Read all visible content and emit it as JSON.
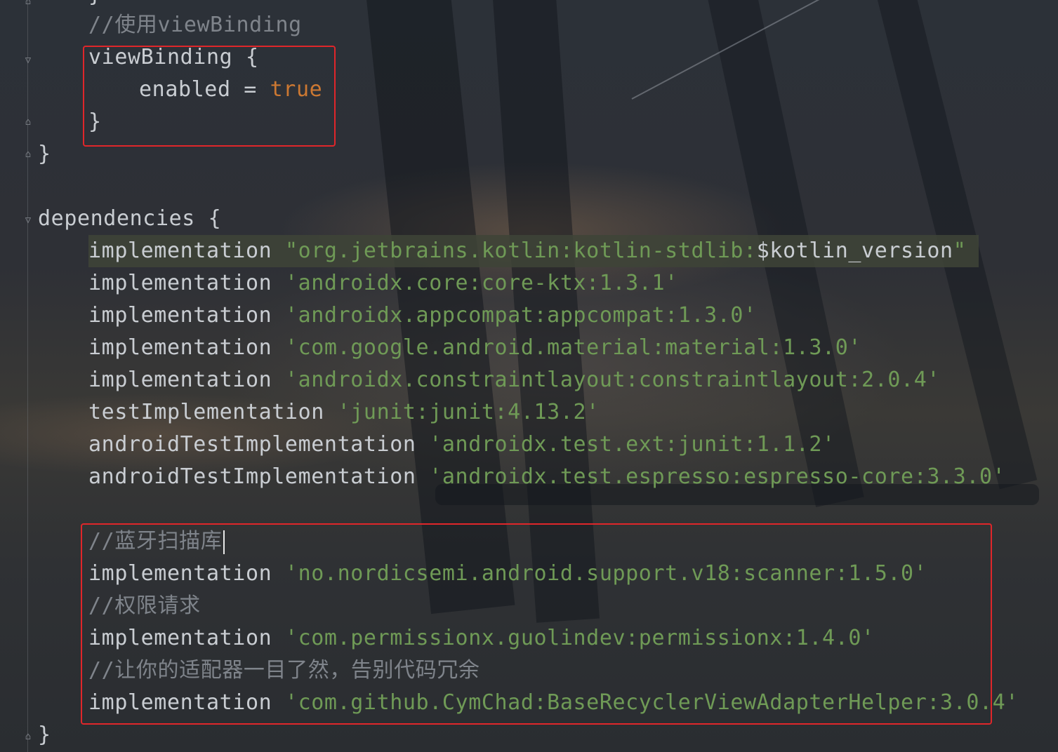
{
  "editor": {
    "lines": {
      "c_viewbinding": "//使用viewBinding",
      "vb_open": "viewBinding {",
      "vb_enabled_key": "enabled = ",
      "vb_enabled_val": "true",
      "vb_close": "}",
      "android_close": "}",
      "deps_open": "dependencies {",
      "dep1_kw": "implementation ",
      "dep1_str": "\"org.jetbrains.kotlin:kotlin-stdlib:",
      "dep1_var": "$kotlin_version",
      "dep1_end": "\"",
      "dep2_kw": "implementation ",
      "dep2_str": "'androidx.core:core-ktx:1.3.1'",
      "dep3_kw": "implementation ",
      "dep3_str": "'androidx.appcompat:appcompat:1.3.0'",
      "dep4_kw": "implementation ",
      "dep4_str": "'com.google.android.material:material:1.3.0'",
      "dep5_kw": "implementation ",
      "dep5_str": "'androidx.constraintlayout:constraintlayout:2.0.4'",
      "dep6_kw": "testImplementation ",
      "dep6_str": "'junit:junit:4.13.2'",
      "dep7_kw": "androidTestImplementation ",
      "dep7_str": "'androidx.test.ext:junit:1.1.2'",
      "dep8_kw": "androidTestImplementation ",
      "dep8_str": "'androidx.test.espresso:espresso-core:3.3.0'",
      "c_bluetooth": "//蓝牙扫描库",
      "dep9_kw": "implementation ",
      "dep9_str": "'no.nordicsemi.android.support.v18:scanner:1.5.0'",
      "c_permission": "//权限请求",
      "dep10_kw": "implementation ",
      "dep10_str": "'com.permissionx.guolindev:permissionx:1.4.0'",
      "c_adapter": "//让你的适配器一目了然，告别代码冗余",
      "dep11_kw": "implementation ",
      "dep11_str": "'com.github.CymChad:BaseRecyclerViewAdapterHelper:3.0.4'",
      "deps_close": "}"
    }
  },
  "colors": {
    "string": "#6f9a56",
    "keyword": "#cc7832",
    "comment": "#7f848b",
    "text": "#c9cdd2",
    "annotation_box": "#e0262a"
  }
}
